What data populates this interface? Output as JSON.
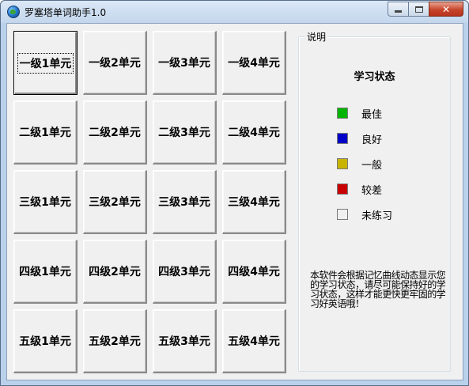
{
  "window": {
    "title": "罗塞塔单词助手1.0",
    "close_glyph": "✕"
  },
  "units": [
    [
      "一级1单元",
      "一级2单元",
      "一级3单元",
      "一级4单元"
    ],
    [
      "二级1单元",
      "二级2单元",
      "二级3单元",
      "二级4单元"
    ],
    [
      "三级1单元",
      "三级2单元",
      "三级3单元",
      "三级4单元"
    ],
    [
      "四级1单元",
      "四级2单元",
      "四级3单元",
      "四级4单元"
    ],
    [
      "五级1单元",
      "五级2单元",
      "五级3单元",
      "五级4单元"
    ]
  ],
  "info_panel": {
    "legend": "说明",
    "status_title": "学习状态",
    "statuses": [
      {
        "label": "最佳",
        "color": "#00b400"
      },
      {
        "label": "良好",
        "color": "#0000c8"
      },
      {
        "label": "一般",
        "color": "#c8b400"
      },
      {
        "label": "较差",
        "color": "#c80000"
      },
      {
        "label": "未练习",
        "color": "#f0f0f0"
      }
    ],
    "description": "本软件会根据记忆曲线动态显示您的学习状态，请尽可能保持好的学习状态，这样才能更快更牢固的学习好英语哦！"
  }
}
